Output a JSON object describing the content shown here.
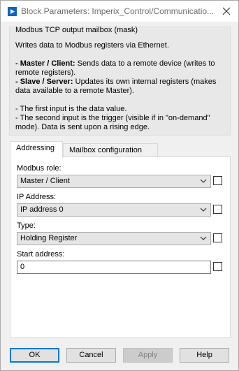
{
  "window": {
    "title": "Block Parameters: Imperix_Control/Communicatio...",
    "icons": {
      "app": "simulink-block-icon",
      "close": "close-icon"
    }
  },
  "description_group": {
    "title": "Modbus TCP output mailbox (mask)",
    "line1": "Writes data to Modbus registers via Ethernet.",
    "master_label": "- Master / Client:",
    "master_text": " Sends data to a remote device (writes to remote registers).",
    "slave_label": "- Slave / Server:",
    "slave_text": " Updates its own internal registers (makes data available to a remote Master).",
    "input1": "- The first input is the data value.",
    "input2": "- The second input is the trigger (visible if in \"on-demand\" mode). Data is sent upon a rising edge."
  },
  "tabs": [
    {
      "label": "Addressing",
      "active": true
    },
    {
      "label": "Mailbox configuration",
      "active": false
    }
  ],
  "addressing": {
    "modbus_role_label": "Modbus role:",
    "modbus_role_value": "Master / Client",
    "ip_address_label": "IP Address:",
    "ip_address_value": "IP address 0",
    "type_label": "Type:",
    "type_value": "Holding Register",
    "start_address_label": "Start address:",
    "start_address_value": "0"
  },
  "buttons": {
    "ok": "OK",
    "cancel": "Cancel",
    "apply": "Apply",
    "help": "Help"
  },
  "colors": {
    "accent": "#0078d7",
    "app_icon": "#0b63c5"
  }
}
